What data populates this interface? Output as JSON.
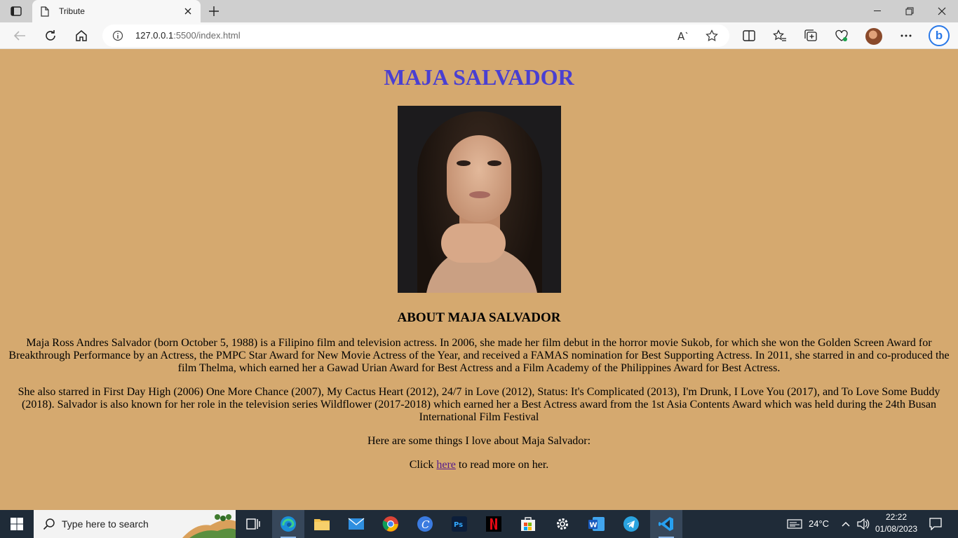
{
  "browser": {
    "tab_title": "Tribute",
    "url_host": "127.0.0.1",
    "url_rest": ":5500/index.html"
  },
  "page": {
    "heading": "MAJA SALVADOR",
    "portrait_alt": "Maja Salvador portrait",
    "about_heading": "ABOUT MAJA SALVADOR",
    "paragraph1": "Maja Ross Andres Salvador (born October 5, 1988) is a Filipino film and television actress. In 2006, she made her film debut in the horror movie Sukob, for which she won the Golden Screen Award for Breakthrough Performance by an Actress, the PMPC Star Award for New Movie Actress of the Year, and received a FAMAS nomination for Best Supporting Actress. In 2011, she starred in and co-produced the film Thelma, which earned her a Gawad Urian Award for Best Actress and a Film Academy of the Philippines Award for Best Actress.",
    "paragraph2": "She also starred in First Day High (2006) One More Chance (2007), My Cactus Heart (2012), 24/7 in Love (2012), Status: It's Complicated (2013), I'm Drunk, I Love You (2017), and To Love Some Buddy (2018). Salvador is also known for her role in the television series Wildflower (2017-2018) which earned her a Best Actress award from the 1st Asia Contents Award which was held during the 24th Busan International Film Festival",
    "things_love": "Here are some things I love about Maja Salvador:",
    "click_prefix": "Click ",
    "link_text": "here",
    "click_suffix": " to read more on her."
  },
  "taskbar": {
    "search_placeholder": "Type here to search",
    "weather": "24°C",
    "time": "22:22",
    "date": "01/08/2023"
  },
  "colors": {
    "page_bg": "#d5a96f",
    "heading": "#4a3fd1",
    "taskbar": "#1f2b38"
  }
}
